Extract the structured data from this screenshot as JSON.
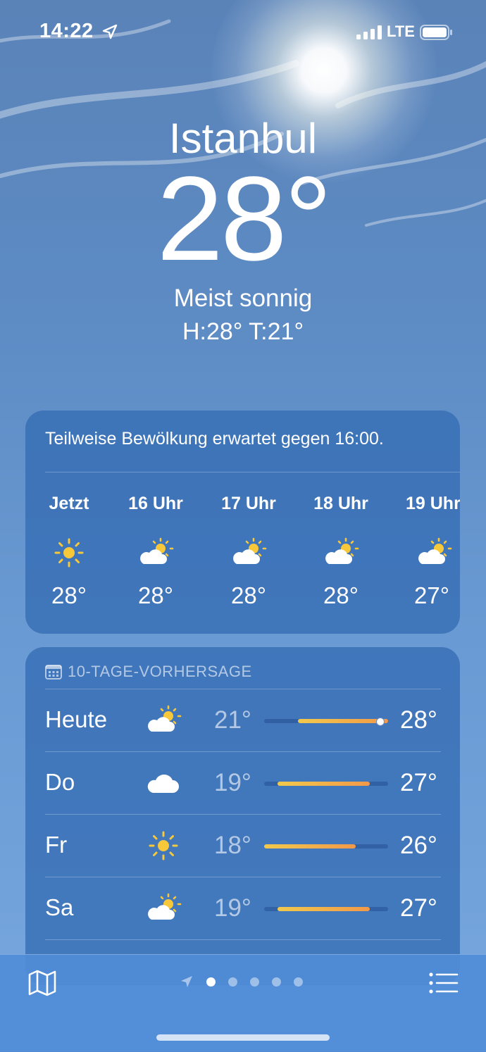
{
  "status_bar": {
    "time": "14:22",
    "network": "LTE"
  },
  "header": {
    "city": "Istanbul",
    "temperature": "28°",
    "condition": "Meist sonnig",
    "high_low": "H:28°  T:21°"
  },
  "hourly": {
    "message": "Teilweise Bewölkung erwartet gegen 16:00.",
    "items": [
      {
        "label": "Jetzt",
        "icon": "sun-icon",
        "temp": "28°"
      },
      {
        "label": "16 Uhr",
        "icon": "partly-cloudy-icon",
        "temp": "28°"
      },
      {
        "label": "17 Uhr",
        "icon": "partly-cloudy-icon",
        "temp": "28°"
      },
      {
        "label": "18 Uhr",
        "icon": "partly-cloudy-icon",
        "temp": "28°"
      },
      {
        "label": "19 Uhr",
        "icon": "partly-cloudy-icon",
        "temp": "27°"
      }
    ]
  },
  "daily": {
    "title": "10-TAGE-VORHERSAGE",
    "days": [
      {
        "name": "Heute",
        "icon": "partly-cloudy-icon",
        "low": "21°",
        "high": "28°",
        "range_start": 0.27,
        "range_end": 1.0,
        "current_marker": 0.93
      },
      {
        "name": "Do",
        "icon": "cloud-icon",
        "low": "19°",
        "high": "27°",
        "range_start": 0.11,
        "range_end": 0.85
      },
      {
        "name": "Fr",
        "icon": "sun-icon",
        "low": "18°",
        "high": "26°",
        "range_start": 0.0,
        "range_end": 0.74
      },
      {
        "name": "Sa",
        "icon": "partly-cloudy-icon",
        "low": "19°",
        "high": "27°",
        "range_start": 0.11,
        "range_end": 0.85
      }
    ]
  },
  "pagination": {
    "count": 5,
    "active_index": 0
  },
  "colors": {
    "card_bg": "#346cb4",
    "bar_yellow": "#f2c94c",
    "bar_orange": "#f2994a",
    "sun_yellow": "#f7c83a"
  }
}
